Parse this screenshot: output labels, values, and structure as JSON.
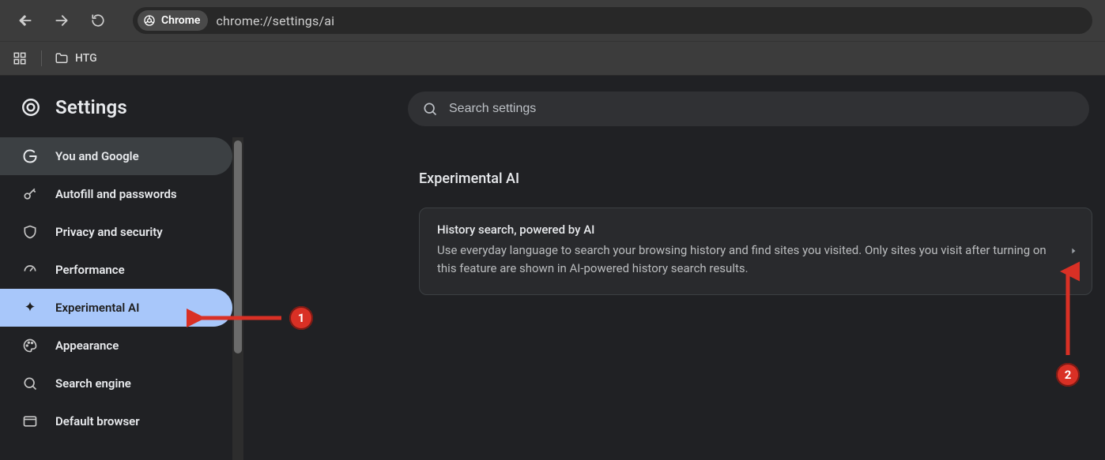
{
  "browser": {
    "chip_label": "Chrome",
    "url": "chrome://settings/ai",
    "bookmark": "HTG"
  },
  "settings_title": "Settings",
  "sidebar": {
    "items": [
      {
        "label": "You and Google"
      },
      {
        "label": "Autofill and passwords"
      },
      {
        "label": "Privacy and security"
      },
      {
        "label": "Performance"
      },
      {
        "label": "Experimental AI"
      },
      {
        "label": "Appearance"
      },
      {
        "label": "Search engine"
      },
      {
        "label": "Default browser"
      }
    ]
  },
  "search": {
    "placeholder": "Search settings"
  },
  "main": {
    "section_title": "Experimental AI",
    "card_title": "History search, powered by AI",
    "card_desc": "Use everyday language to search your browsing history and find sites you visited. Only sites you visit after turning on this feature are shown in AI-powered history search results."
  },
  "annotations": {
    "one": "1",
    "two": "2"
  }
}
